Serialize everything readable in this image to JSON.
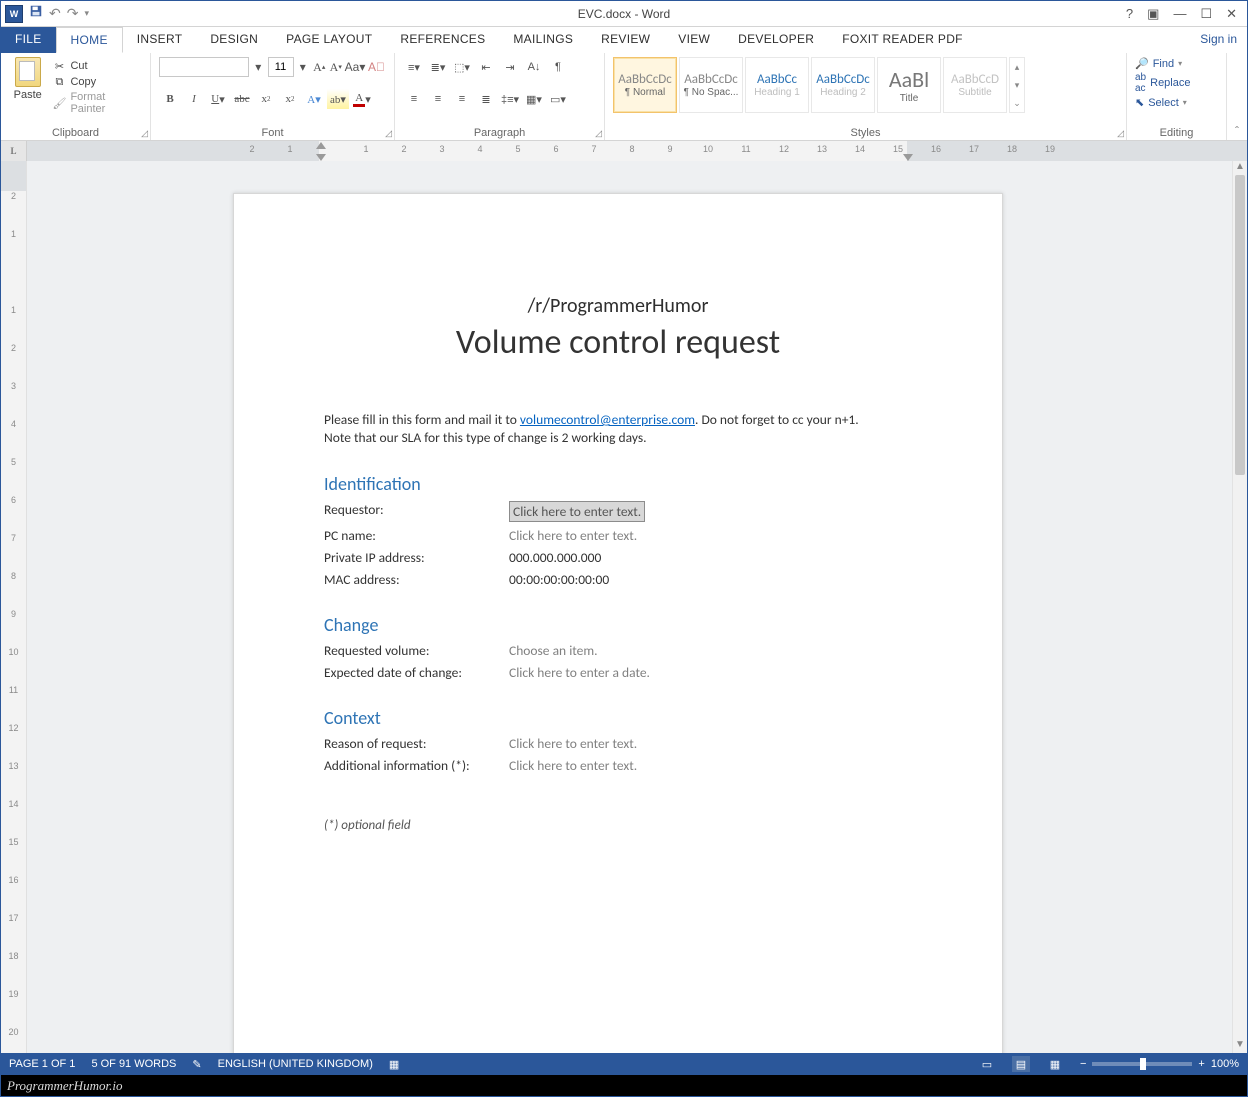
{
  "window": {
    "title": "EVC.docx - Word",
    "signin": "Sign in"
  },
  "qat": {
    "app": "W",
    "save": "💾",
    "undo": "↶",
    "redo": "↷",
    "customize": "▾"
  },
  "tabs": [
    "FILE",
    "HOME",
    "INSERT",
    "DESIGN",
    "PAGE LAYOUT",
    "REFERENCES",
    "MAILINGS",
    "REVIEW",
    "VIEW",
    "DEVELOPER",
    "FOXIT READER PDF"
  ],
  "ribbon": {
    "clipboard": {
      "label": "Clipboard",
      "paste": "Paste",
      "cut": "Cut",
      "copy": "Copy",
      "format_painter": "Format Painter"
    },
    "font": {
      "label": "Font",
      "name": "",
      "size": "11"
    },
    "paragraph": {
      "label": "Paragraph"
    },
    "styles": {
      "label": "Styles",
      "items": [
        {
          "preview": "AaBbCcDc",
          "name": "¶ Normal",
          "sel": true
        },
        {
          "preview": "AaBbCcDc",
          "name": "¶ No Spac...",
          "sel": false
        },
        {
          "preview": "AaBbCc",
          "name": "Heading 1",
          "sel": false,
          "dim": true,
          "blue": true
        },
        {
          "preview": "AaBbCcDc",
          "name": "Heading 2",
          "sel": false,
          "dim": true,
          "blue": true
        },
        {
          "preview": "AaBl",
          "name": "Title",
          "sel": false,
          "big": true
        },
        {
          "preview": "AaBbCcD",
          "name": "Subtitle",
          "sel": false,
          "dim": true
        }
      ]
    },
    "editing": {
      "label": "Editing",
      "find": "Find",
      "replace": "Replace",
      "select": "Select"
    }
  },
  "ruler": {
    "h": [
      "2",
      "1",
      "",
      "1",
      "2",
      "3",
      "4",
      "5",
      "6",
      "7",
      "8",
      "9",
      "10",
      "11",
      "12",
      "13",
      "14",
      "15",
      "16",
      "17",
      "18",
      "19"
    ],
    "v": [
      "2",
      "1",
      "",
      "1",
      "2",
      "3",
      "4",
      "5",
      "6",
      "7",
      "8",
      "9",
      "10",
      "11",
      "12",
      "13",
      "14",
      "15",
      "16",
      "17",
      "18",
      "19",
      "20"
    ]
  },
  "doc": {
    "subtitle": "/r/ProgrammerHumor",
    "title": "Volume control request",
    "intro1a": "Please fill in this form and mail it to ",
    "intro1link": "volumecontrol@enterprise.com",
    "intro1b": ". Do not forget to cc your n+1.",
    "intro2": "Note that our SLA for this type of change is 2 working days.",
    "sections": {
      "identification": {
        "heading": "Identification",
        "rows": [
          {
            "lbl": "Requestor:",
            "val": "Click here to enter text.",
            "ph": true,
            "boxed": true
          },
          {
            "lbl": "PC name:",
            "val": "Click here to enter text.",
            "ph": true
          },
          {
            "lbl": "Private IP address:",
            "val": "000.000.000.000"
          },
          {
            "lbl": "MAC address:",
            "val": "00:00:00:00:00:00"
          }
        ]
      },
      "change": {
        "heading": "Change",
        "rows": [
          {
            "lbl": "Requested volume:",
            "val": "Choose an item.",
            "ph": true
          },
          {
            "lbl": "Expected date of change:",
            "val": "Click here to enter a date.",
            "ph": true
          }
        ]
      },
      "context": {
        "heading": "Context",
        "rows": [
          {
            "lbl": "Reason of request:",
            "val": "Click here to enter text.",
            "ph": true
          },
          {
            "lbl": "Additional information (*):",
            "val": "Click here to enter text.",
            "ph": true
          }
        ]
      }
    },
    "footnote": "(*) optional field"
  },
  "status": {
    "page": "PAGE 1 OF 1",
    "words": "5 OF 91 WORDS",
    "lang": "ENGLISH (UNITED KINGDOM)",
    "zoom": "100%"
  },
  "watermark": "ProgrammerHumor.io"
}
